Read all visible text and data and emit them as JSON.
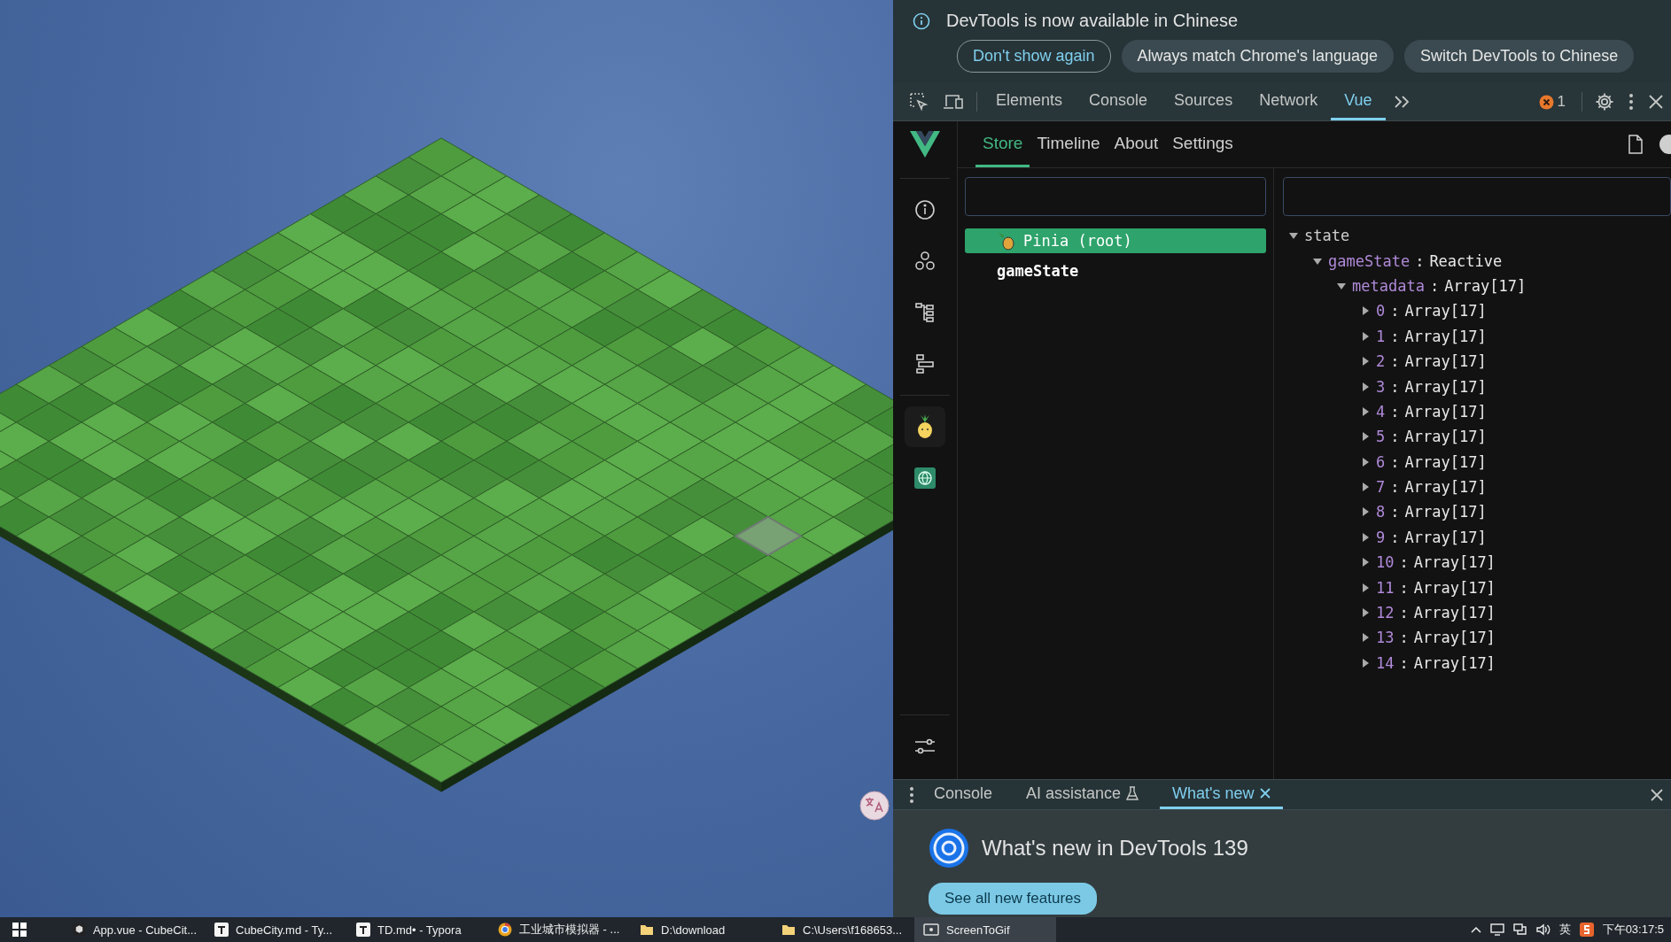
{
  "infobar": {
    "message": "DevTools is now available in Chinese",
    "buttons": [
      {
        "label": "Don't show again",
        "kind": "outline"
      },
      {
        "label": "Always match Chrome's language",
        "kind": "filled"
      },
      {
        "label": "Switch DevTools to Chinese",
        "kind": "filled"
      }
    ]
  },
  "toolbar": {
    "tabs": [
      {
        "label": "Elements",
        "selected": false
      },
      {
        "label": "Console",
        "selected": false
      },
      {
        "label": "Sources",
        "selected": false
      },
      {
        "label": "Network",
        "selected": false
      },
      {
        "label": "Vue",
        "selected": true
      }
    ],
    "error_count": "1"
  },
  "vue": {
    "tabs": [
      {
        "label": "Store",
        "selected": true
      },
      {
        "label": "Timeline",
        "selected": false
      },
      {
        "label": "About",
        "selected": false
      },
      {
        "label": "Settings",
        "selected": false
      }
    ],
    "stores": [
      {
        "label": "Pinia (root)",
        "selected": true,
        "kind": "root"
      },
      {
        "label": "gameState",
        "selected": false,
        "kind": "store"
      }
    ],
    "state_tree": [
      {
        "key": "state",
        "expanded": true,
        "children": [
          {
            "key": "gameState",
            "separator": ":",
            "value": "Reactive",
            "expanded": true,
            "children": [
              {
                "key": "metadata",
                "separator": ":",
                "value": "Array[17]",
                "expanded": true,
                "children": [
                  {
                    "key": "0",
                    "separator": ":",
                    "value": "Array[17]",
                    "expanded": false
                  },
                  {
                    "key": "1",
                    "separator": ":",
                    "value": "Array[17]",
                    "expanded": false
                  },
                  {
                    "key": "2",
                    "separator": ":",
                    "value": "Array[17]",
                    "expanded": false
                  },
                  {
                    "key": "3",
                    "separator": ":",
                    "value": "Array[17]",
                    "expanded": false
                  },
                  {
                    "key": "4",
                    "separator": ":",
                    "value": "Array[17]",
                    "expanded": false
                  },
                  {
                    "key": "5",
                    "separator": ":",
                    "value": "Array[17]",
                    "expanded": false
                  },
                  {
                    "key": "6",
                    "separator": ":",
                    "value": "Array[17]",
                    "expanded": false
                  },
                  {
                    "key": "7",
                    "separator": ":",
                    "value": "Array[17]",
                    "expanded": false
                  },
                  {
                    "key": "8",
                    "separator": ":",
                    "value": "Array[17]",
                    "expanded": false
                  },
                  {
                    "key": "9",
                    "separator": ":",
                    "value": "Array[17]",
                    "expanded": false
                  },
                  {
                    "key": "10",
                    "separator": ":",
                    "value": "Array[17]",
                    "expanded": false
                  },
                  {
                    "key": "11",
                    "separator": ":",
                    "value": "Array[17]",
                    "expanded": false
                  },
                  {
                    "key": "12",
                    "separator": ":",
                    "value": "Array[17]",
                    "expanded": false
                  },
                  {
                    "key": "13",
                    "separator": ":",
                    "value": "Array[17]",
                    "expanded": false
                  },
                  {
                    "key": "14",
                    "separator": ":",
                    "value": "Array[17]",
                    "expanded": false
                  }
                ]
              }
            ]
          }
        ]
      }
    ]
  },
  "drawer": {
    "tabs": [
      {
        "label": "Console",
        "selected": false,
        "kind": "plain"
      },
      {
        "label": "AI assistance",
        "selected": false,
        "kind": "experimental"
      },
      {
        "label": "What's new",
        "selected": true,
        "kind": "closable"
      }
    ],
    "heading": "What's new in DevTools 139",
    "button": "See all new features"
  },
  "taskbar": {
    "items": [
      {
        "label": "App.vue - CubeCit...",
        "kind": "editor",
        "selected": false
      },
      {
        "label": "CubeCity.md - Ty...",
        "kind": "typora",
        "selected": false
      },
      {
        "label": "TD.md• - Typora",
        "kind": "typora",
        "selected": false
      },
      {
        "label": "工业城市模拟器 - ...",
        "kind": "browser",
        "selected": false
      },
      {
        "label": "D:\\download",
        "kind": "folder",
        "selected": false
      },
      {
        "label": "C:\\Users\\f168653...",
        "kind": "folder",
        "selected": false
      },
      {
        "label": "ScreenToGif",
        "kind": "recorder",
        "selected": true
      }
    ],
    "ime": "英",
    "clock": "下午03:17:5"
  }
}
